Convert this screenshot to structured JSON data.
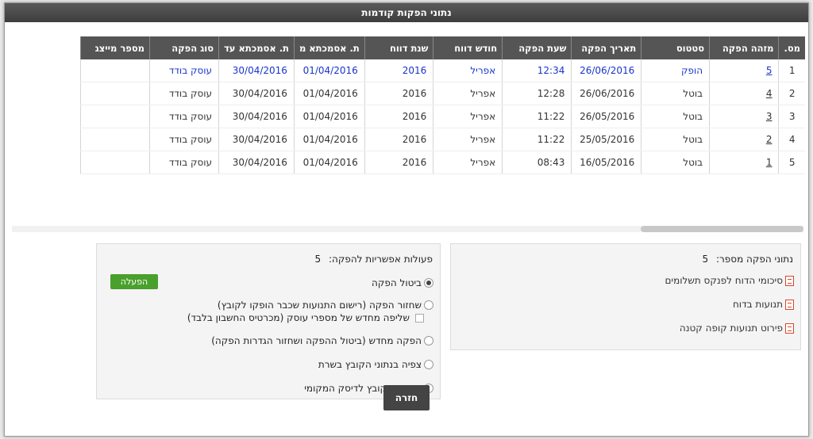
{
  "title": "נתוני הפקות קודמות",
  "columns": [
    "מס.",
    "מזהה הפקה",
    "סטטוס",
    "תאריך הפקה",
    "שעת הפקה",
    "חודש דווח",
    "שנת דווח",
    "ת. אסמכתא מ",
    "ת. אסמכתא עד",
    "סוג הפקה",
    "מספר מייצג"
  ],
  "rows": [
    [
      "1",
      "5",
      "הופק",
      "26/06/2016",
      "12:34",
      "אפריל",
      "2016",
      "01/04/2016",
      "30/04/2016",
      "עוסק בודד",
      ""
    ],
    [
      "2",
      "4",
      "בוטל",
      "26/06/2016",
      "12:28",
      "אפריל",
      "2016",
      "01/04/2016",
      "30/04/2016",
      "עוסק בודד",
      ""
    ],
    [
      "3",
      "3",
      "בוטל",
      "26/05/2016",
      "11:22",
      "אפריל",
      "2016",
      "01/04/2016",
      "30/04/2016",
      "עוסק בודד",
      ""
    ],
    [
      "4",
      "2",
      "בוטל",
      "25/05/2016",
      "11:22",
      "אפריל",
      "2016",
      "01/04/2016",
      "30/04/2016",
      "עוסק בודד",
      ""
    ],
    [
      "5",
      "1",
      "בוטל",
      "16/05/2016",
      "08:43",
      "אפריל",
      "2016",
      "01/04/2016",
      "30/04/2016",
      "עוסק בודד",
      ""
    ]
  ],
  "actions_panel": {
    "title": "פעולות אפשריות להפקה:",
    "production_number": "5",
    "run_label": "הפעלה",
    "options": [
      "ביטול הפקה",
      "שחזור הפקה (רישום התנועות שכבר הופקו לקובץ)",
      "שליפה מחדש של מספרי עוסק (מכרטיס החשבון בלבד)",
      "הפקה מחדש (ביטול ההפקה ושחזור הגדרות הפקה)",
      "צפיה בנתוני הקובץ בשרת",
      "הורדת הקובץ לדיסק המקומי"
    ]
  },
  "info_panel": {
    "title": "נתוני הפקה מספר:",
    "production_number": "5",
    "links": [
      "סיכומי הדוח לפנקס תשלומים",
      "תנועות בדוח",
      "פירוט תנועות קופה קטנה"
    ]
  },
  "back_label": "חזרה"
}
